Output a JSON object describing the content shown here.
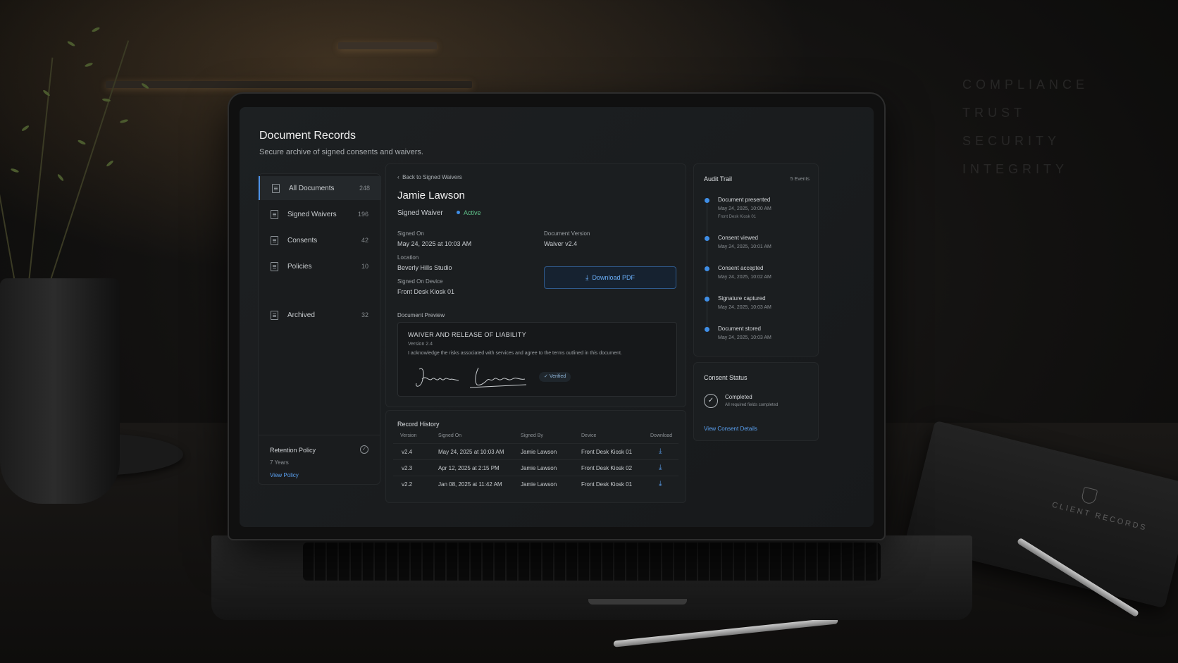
{
  "environment": {
    "wall_words": [
      "COMPLIANCE",
      "TRUST",
      "SECURITY",
      "INTEGRITY"
    ],
    "notebook_label": "CLIENT RECORDS"
  },
  "page": {
    "title": "Document Records",
    "subtitle": "Secure archive of signed consents and waivers."
  },
  "sidebar": {
    "items": [
      {
        "label": "All Documents",
        "count": "248",
        "active": true
      },
      {
        "label": "Signed Waivers",
        "count": "196",
        "active": false
      },
      {
        "label": "Consents",
        "count": "42",
        "active": false
      },
      {
        "label": "Policies",
        "count": "10",
        "active": false
      }
    ],
    "archived": {
      "label": "Archived",
      "count": "32"
    },
    "retention": {
      "title": "Retention Policy",
      "value": "7 Years",
      "link": "View Policy"
    }
  },
  "record": {
    "back_link": "Back to Signed Waivers",
    "name": "Jamie Lawson",
    "type": "Signed Waiver",
    "status": "Active",
    "signed_on_label": "Signed On",
    "signed_on": "May 24, 2025 at 10:03 AM",
    "location_label": "Location",
    "location": "Beverly Hills Studio",
    "device_label": "Signed On Device",
    "device": "Front Desk Kiosk 01",
    "version_label": "Document Version",
    "version": "Waiver v2.4",
    "download_label": "Download PDF"
  },
  "preview": {
    "label": "Document Preview",
    "title": "WAIVER AND RELEASE OF LIABILITY",
    "version": "Version 2.4",
    "text": "I acknowledge the risks associated with services and agree to the terms outlined in this document.",
    "signature": "Jamie Lawson",
    "verified": "Verified"
  },
  "history": {
    "title": "Record History",
    "columns": [
      "Version",
      "Signed On",
      "Signed By",
      "Device",
      "Download"
    ],
    "rows": [
      {
        "version": "v2.4",
        "signed_on": "May 24, 2025 at 10:03 AM",
        "signed_by": "Jamie Lawson",
        "device": "Front Desk Kiosk 01"
      },
      {
        "version": "v2.3",
        "signed_on": "Apr 12, 2025 at 2:15 PM",
        "signed_by": "Jamie Lawson",
        "device": "Front Desk Kiosk 02"
      },
      {
        "version": "v2.2",
        "signed_on": "Jan 08, 2025 at 11:42 AM",
        "signed_by": "Jamie Lawson",
        "device": "Front Desk Kiosk 01"
      }
    ]
  },
  "audit": {
    "title": "Audit Trail",
    "count": "5 Events",
    "events": [
      {
        "title": "Document presented",
        "time": "May 24, 2025, 10:00 AM",
        "device": "Front Desk Kiosk 01"
      },
      {
        "title": "Consent viewed",
        "time": "May 24, 2025, 10:01 AM"
      },
      {
        "title": "Consent accepted",
        "time": "May 24, 2025, 10:02 AM"
      },
      {
        "title": "Signature captured",
        "time": "May 24, 2025, 10:03 AM"
      },
      {
        "title": "Document stored",
        "time": "May 24, 2025, 10:03 AM"
      }
    ]
  },
  "consent": {
    "title": "Consent Status",
    "status": "Completed",
    "sub": "All required fields completed",
    "link": "View Consent Details"
  },
  "colors": {
    "accent": "#3f8ee6",
    "active_status": "#5fc28a",
    "link": "#5aa0f0"
  }
}
